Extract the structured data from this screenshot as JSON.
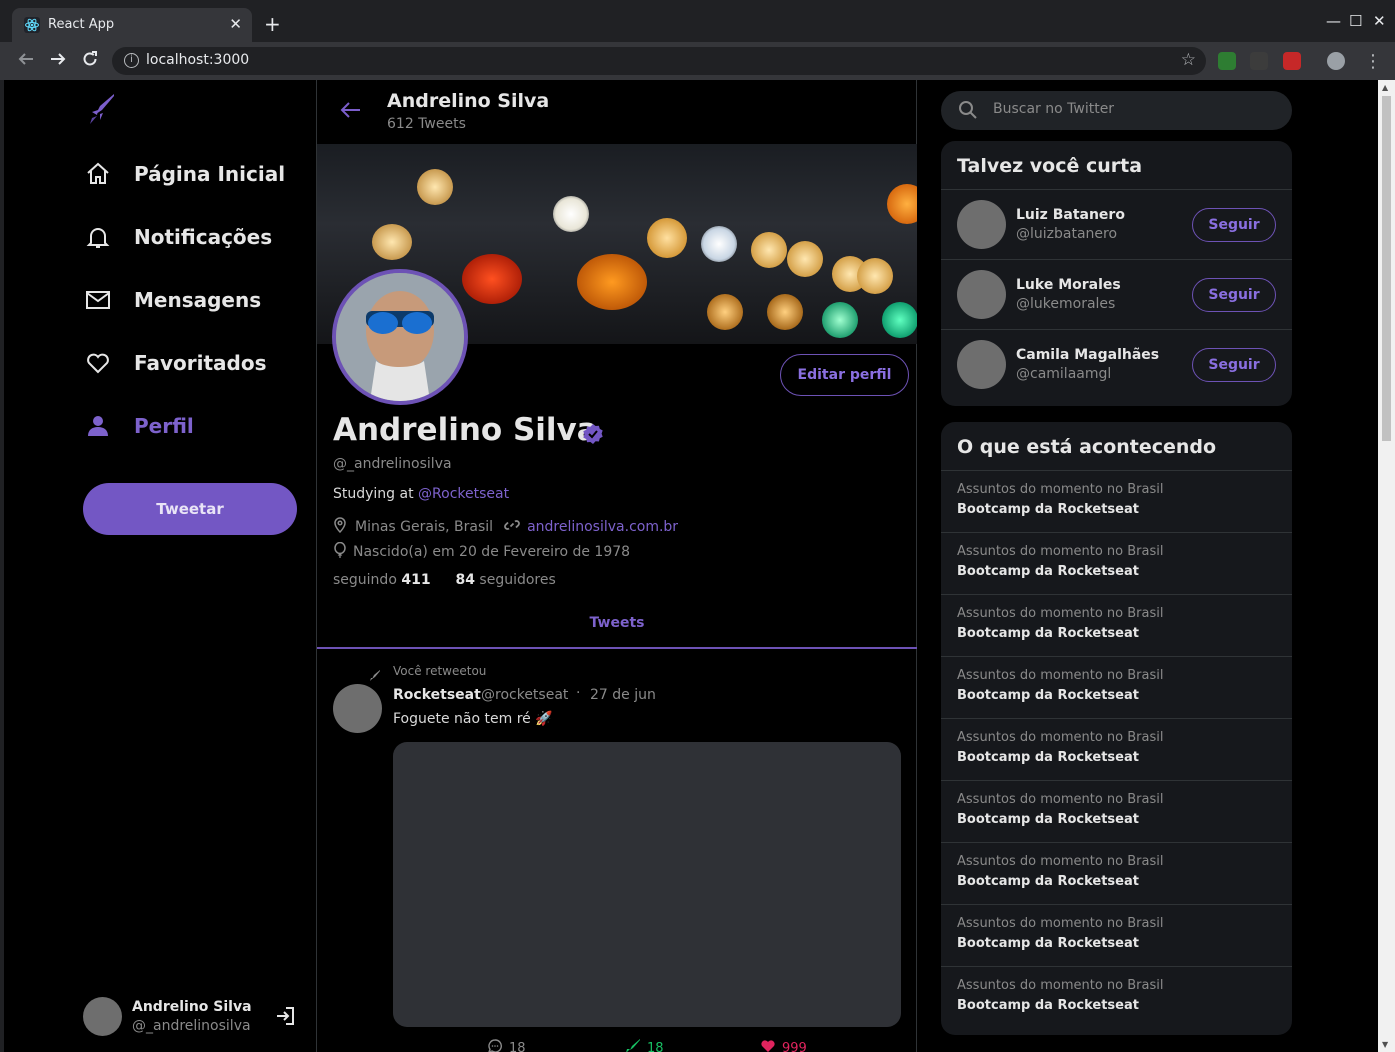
{
  "browser": {
    "tab_title": "React App",
    "url": "localhost:3000",
    "close_glyph": "✕",
    "new_tab_glyph": "+",
    "minimize_glyph": "—",
    "maximize_glyph": "☐",
    "window_close_glyph": "✕"
  },
  "sidebar": {
    "items": [
      {
        "label": "Página Inicial",
        "icon": "home-icon"
      },
      {
        "label": "Notificações",
        "icon": "bell-icon"
      },
      {
        "label": "Mensagens",
        "icon": "mail-icon"
      },
      {
        "label": "Favoritados",
        "icon": "heart-icon"
      },
      {
        "label": "Perfil",
        "icon": "person-icon",
        "active": true
      }
    ],
    "tweet_button": "Tweetar",
    "profile": {
      "name": "Andrelino Silva",
      "handle": "@_andrelinosilva"
    }
  },
  "header": {
    "name": "Andrelino Silva",
    "tweet_count": "612 Tweets"
  },
  "profile": {
    "edit_button": "Editar perfil",
    "name": "Andrelino Silva",
    "handle": "@_andrelinosilva",
    "bio_prefix": "Studying at ",
    "bio_link": "@Rocketseat",
    "location": "Minas Gerais, Brasil",
    "website": "andrelinosilva.com.br",
    "birth": "Nascido(a) em 20 de Fevereiro de 1978",
    "following_label": "seguindo",
    "following_count": "411",
    "followers_count": "84",
    "followers_label": "seguidores",
    "tab": "Tweets"
  },
  "tweet": {
    "retweet_label": "Você retweetou",
    "author": "Rocketseat",
    "handle": "@rocketseat",
    "separator": "·",
    "date": "27 de jun",
    "text": "Foguete não tem ré 🚀",
    "comments": "18",
    "retweets": "18",
    "likes": "999"
  },
  "colors": {
    "accent": "#7357c4",
    "retweet": "#17bf63",
    "like": "#e0245e"
  },
  "search": {
    "placeholder": "Buscar no Twitter"
  },
  "follow_suggestions": {
    "title": "Talvez você curta",
    "button_label": "Seguir",
    "users": [
      {
        "name": "Luiz Batanero",
        "handle": "@luizbatanero"
      },
      {
        "name": "Luke Morales",
        "handle": "@lukemorales"
      },
      {
        "name": "Camila Magalhães",
        "handle": "@camilaamgl"
      }
    ]
  },
  "trends": {
    "title": "O que está acontecendo",
    "items": [
      {
        "context": "Assuntos do momento no Brasil",
        "topic": "Bootcamp da Rocketseat"
      },
      {
        "context": "Assuntos do momento no Brasil",
        "topic": "Bootcamp da Rocketseat"
      },
      {
        "context": "Assuntos do momento no Brasil",
        "topic": "Bootcamp da Rocketseat"
      },
      {
        "context": "Assuntos do momento no Brasil",
        "topic": "Bootcamp da Rocketseat"
      },
      {
        "context": "Assuntos do momento no Brasil",
        "topic": "Bootcamp da Rocketseat"
      },
      {
        "context": "Assuntos do momento no Brasil",
        "topic": "Bootcamp da Rocketseat"
      },
      {
        "context": "Assuntos do momento no Brasil",
        "topic": "Bootcamp da Rocketseat"
      },
      {
        "context": "Assuntos do momento no Brasil",
        "topic": "Bootcamp da Rocketseat"
      },
      {
        "context": "Assuntos do momento no Brasil",
        "topic": "Bootcamp da Rocketseat"
      }
    ]
  }
}
